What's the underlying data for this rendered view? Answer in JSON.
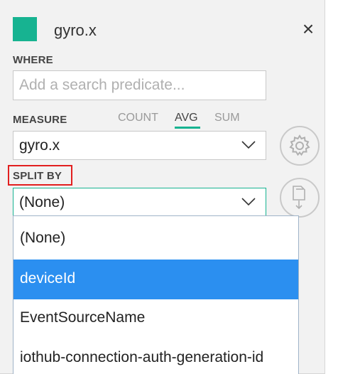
{
  "header": {
    "title": "gyro.x",
    "swatch_color": "#17b391",
    "close_glyph": "×"
  },
  "where": {
    "label": "WHERE",
    "placeholder": "Add a search predicate..."
  },
  "measure": {
    "label": "MEASURE",
    "tabs": [
      {
        "label": "COUNT",
        "active": false
      },
      {
        "label": "AVG",
        "active": true
      },
      {
        "label": "SUM",
        "active": false
      }
    ],
    "accent_color": "#17b391",
    "selected": "gyro.x"
  },
  "split_by": {
    "label": "SPLIT BY",
    "selected": "(None)",
    "border_color": "#17b391",
    "options": [
      {
        "label": "(None)",
        "selected": false
      },
      {
        "label": "deviceId",
        "selected": true
      },
      {
        "label": "EventSourceName",
        "selected": false
      },
      {
        "label": "iothub-connection-auth-generation-id",
        "selected": false
      }
    ]
  },
  "colors": {
    "option_highlight": "#2b8ff0",
    "annotation_box": "#e21f1f"
  },
  "icons": {
    "settings": "gear-icon",
    "download": "download-file-icon",
    "chevron": "chevron-down-icon"
  }
}
